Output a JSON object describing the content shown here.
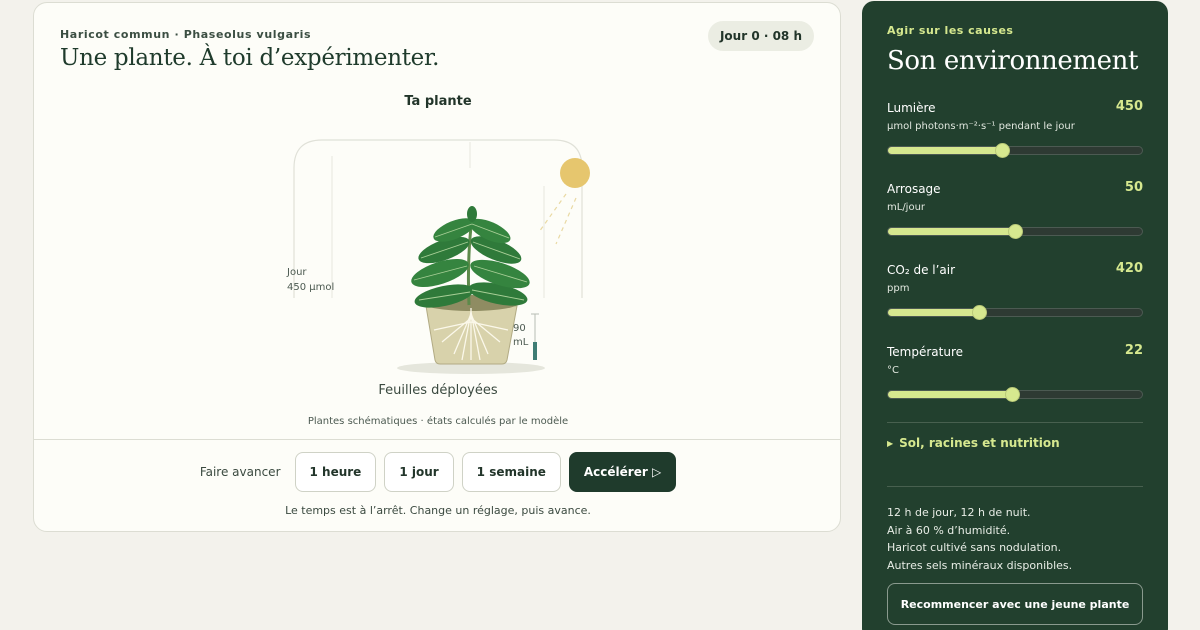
{
  "experiment": {
    "eyebrow": "Haricot commun · Phaseolus vulgaris",
    "title": "Une plante. À toi d’expérimenter.",
    "clock": "Jour 0 · 08 h",
    "plant_heading": "Ta plante",
    "day_label": "Jour",
    "light_label": "450 µmol",
    "water_value": "90",
    "water_unit": "mL",
    "plant_state": "Feuilles déployées",
    "footnote": "Plantes schématiques · états calculés par le modèle",
    "advance_label": "Faire avancer",
    "buttons": {
      "hour": "1 heure",
      "day": "1 jour",
      "week": "1 semaine",
      "accelerate": "Accélérer ▷"
    },
    "status": "Le temps est à l’arrêt. Change un réglage, puis avance."
  },
  "environment": {
    "eyebrow": "Agir sur les causes",
    "title": "Son environnement",
    "controls": [
      {
        "name": "Lumière",
        "value": "450",
        "unit": "µmol photons·m⁻²·s⁻¹ pendant le jour",
        "fraction": 0.45
      },
      {
        "name": "Arrosage",
        "value": "50",
        "unit": "mL/jour",
        "fraction": 0.5
      },
      {
        "name": "CO₂ de l’air",
        "value": "420",
        "unit": "ppm",
        "fraction": 0.36
      },
      {
        "name": "Température",
        "value": "22",
        "unit": "°C",
        "fraction": 0.49
      }
    ],
    "expander": "Sol, racines et nutrition",
    "notes": [
      "12 h de jour, 12 h de nuit.",
      "Air à 60 % d’humidité.",
      "Haricot cultivé sans nodulation.",
      "Autres sels minéraux disponibles."
    ],
    "reset": "Recommencer avec une jeune plante"
  },
  "colors": {
    "accent": "#d6e88f",
    "panel": "#22402e",
    "leaf": "#2f7a3a",
    "sun": "#e6c66e"
  }
}
